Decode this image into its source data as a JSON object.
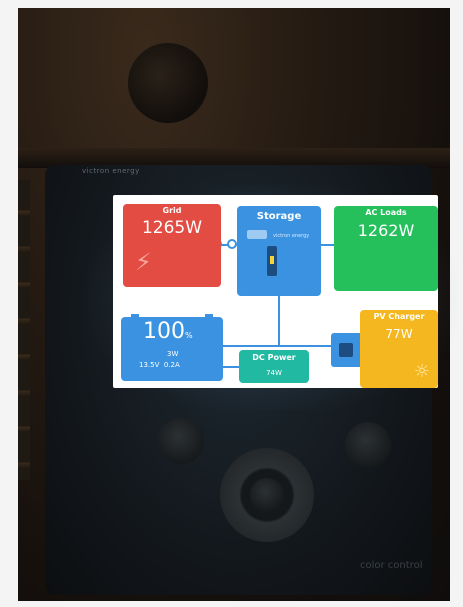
{
  "device": {
    "brand_top": "victron energy",
    "brand_bottom": "color control"
  },
  "screen": {
    "grid": {
      "title": "Grid",
      "value": "1265W",
      "icon": "power-pylon-icon"
    },
    "storage": {
      "title": "Storage",
      "subtitle": "victron energy"
    },
    "ac_loads": {
      "title": "AC Loads",
      "value": "1262W"
    },
    "battery": {
      "soc": "100",
      "soc_unit": "%",
      "power": "3W",
      "voltage": "13.5V",
      "current": "0.2A"
    },
    "dc_power": {
      "title": "DC Power",
      "value": "74W"
    },
    "pv_charger": {
      "title": "PV Charger",
      "value": "77W",
      "icon": "sun-icon"
    }
  },
  "colors": {
    "grid": "#e24c42",
    "storage": "#3a92e0",
    "ac_loads": "#25c05b",
    "dc_power": "#22b9a2",
    "pv_charger": "#f4b71f"
  }
}
